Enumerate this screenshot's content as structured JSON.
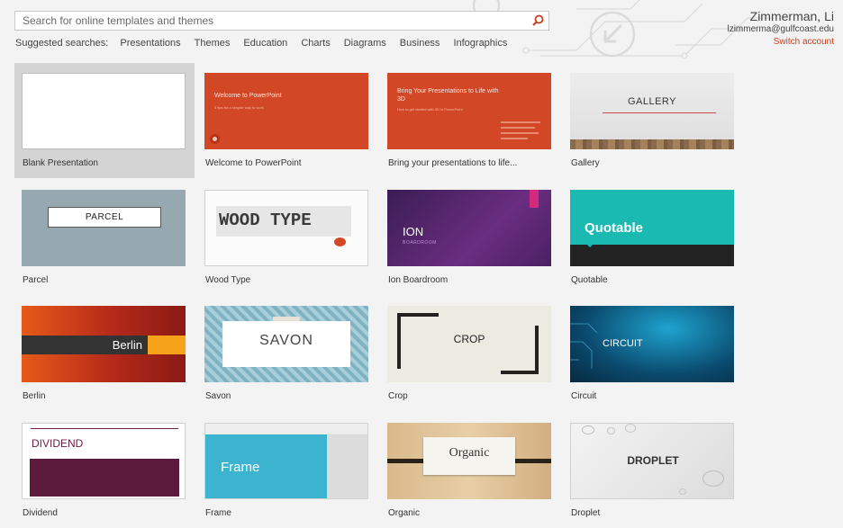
{
  "search": {
    "placeholder": "Search for online templates and themes",
    "button_icon": "search-icon"
  },
  "suggested": {
    "label": "Suggested searches:",
    "items": [
      "Presentations",
      "Themes",
      "Education",
      "Charts",
      "Diagrams",
      "Business",
      "Infographics"
    ]
  },
  "account": {
    "name": "Zimmerman, Li",
    "email": "lzimmerma@gulfcoast.edu",
    "switch_label": "Switch account"
  },
  "colors": {
    "accent": "#c43e1c",
    "background": "#f3f3f3",
    "selected_tile": "#d4d4d4"
  },
  "templates": [
    {
      "label": "Blank Presentation",
      "selected": true
    },
    {
      "label": "Welcome to PowerPoint",
      "thumb_title": "Welcome to PowerPoint",
      "thumb_subtitle": "5 tips for a simpler way to work"
    },
    {
      "label": "Bring your presentations to life...",
      "thumb_title": "Bring Your Presentations to Life with 3D",
      "thumb_subtitle": "How to get started with 3D in PowerPoint"
    },
    {
      "label": "Gallery",
      "thumb_title": "GALLERY"
    },
    {
      "label": "Parcel",
      "thumb_title": "PARCEL"
    },
    {
      "label": "Wood Type",
      "thumb_title": "WOOD TYPE"
    },
    {
      "label": "Ion Boardroom",
      "thumb_title": "ION",
      "thumb_subtitle": "BOARDROOM"
    },
    {
      "label": "Quotable",
      "thumb_title": "Quotable"
    },
    {
      "label": "Berlin",
      "thumb_title": "Berlin"
    },
    {
      "label": "Savon",
      "thumb_title": "SAVON"
    },
    {
      "label": "Crop",
      "thumb_title": "CROP"
    },
    {
      "label": "Circuit",
      "thumb_title": "CIRCUIT"
    },
    {
      "label": "Dividend",
      "thumb_title": "DIVIDEND"
    },
    {
      "label": "Frame",
      "thumb_title": "Frame"
    },
    {
      "label": "Organic",
      "thumb_title": "Organic"
    },
    {
      "label": "Droplet",
      "thumb_title": "DROPLET"
    }
  ]
}
